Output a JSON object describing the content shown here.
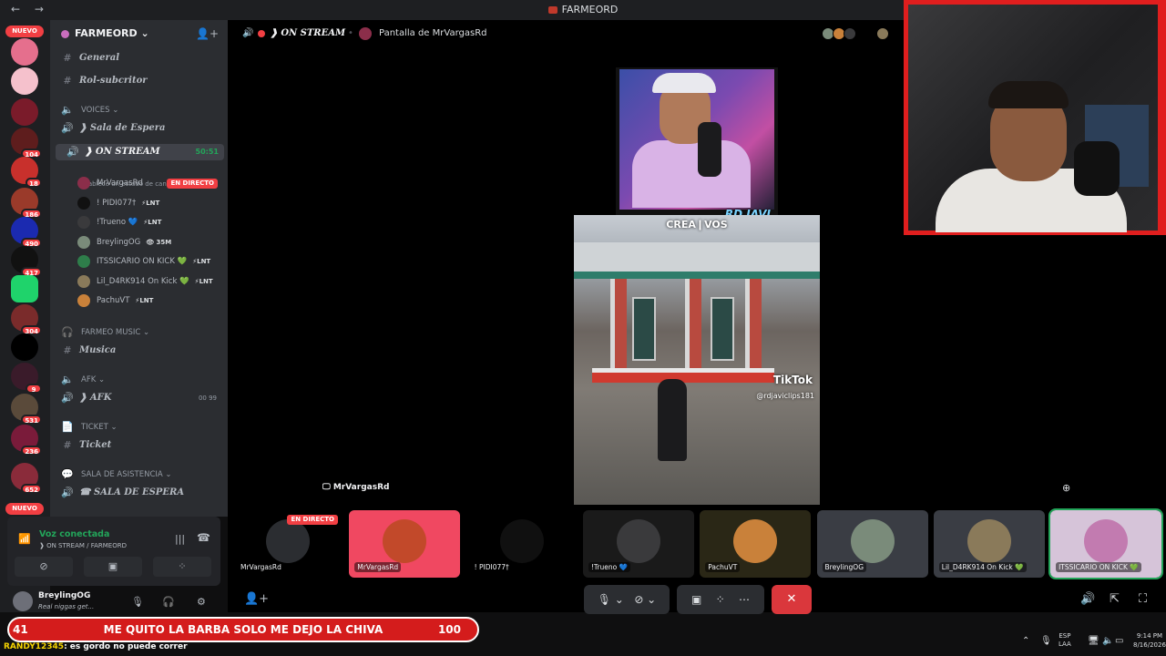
{
  "titlebar": {
    "nav": "← →",
    "title": "FARMEORD"
  },
  "servers": {
    "new1": "NUEVO",
    "new2": "NUEVO",
    "counts": [
      "104",
      "18",
      "186",
      "490",
      "417",
      "304",
      "9",
      "531",
      "236",
      "652"
    ]
  },
  "server": {
    "name": "FARMEORD ⌄"
  },
  "channels": [
    {
      "type": "text",
      "icon": "#",
      "label": "General"
    },
    {
      "type": "text",
      "icon": "#",
      "label": "Rol-subcritor"
    },
    {
      "type": "cat",
      "icon": "🔈",
      "label": "VOICES ⌄"
    },
    {
      "type": "voice",
      "icon": "🔊",
      "label": "❱ Sala de Espera"
    },
    {
      "type": "voice-active",
      "icon": "🔊",
      "label": "❱ ON STREAM",
      "timer": "50:51"
    }
  ],
  "channel_status": "Establece un estado de canal ✎",
  "voice_users": [
    {
      "name": "MrVargasRd",
      "tag": "",
      "badge": "EN DIRECTO"
    },
    {
      "name": "! PIDI077†",
      "tag": "⚡LNT",
      "badge": ""
    },
    {
      "name": "!Trueno 💙",
      "tag": "⚡LNT",
      "badge": ""
    },
    {
      "name": "BreylingOG",
      "tag": "👁 35M",
      "badge": ""
    },
    {
      "name": "ITSSICARIO ON KICK 💚",
      "tag": "⚡LNT",
      "badge": ""
    },
    {
      "name": "Lil_D4RK914 On Kick 💚",
      "tag": "⚡LNT",
      "badge": ""
    },
    {
      "name": "PachuVT",
      "tag": "⚡LNT",
      "badge": ""
    }
  ],
  "channels2": [
    {
      "type": "cat",
      "icon": "🎧",
      "label": "FARMEO MUSIC ⌄"
    },
    {
      "type": "text",
      "icon": "#",
      "label": "Musica"
    },
    {
      "type": "cat",
      "icon": "🔈",
      "label": "AFK ⌄"
    },
    {
      "type": "voice",
      "icon": "🔊",
      "label": "❱ AFK",
      "extra": "00 99"
    },
    {
      "type": "cat",
      "icon": "📄",
      "label": "TICKET ⌄"
    },
    {
      "type": "text",
      "icon": "#",
      "label": "Ticket"
    },
    {
      "type": "cat",
      "icon": "💬",
      "label": "SALA DE ASISTENCIA ⌄"
    },
    {
      "type": "voice",
      "icon": "🔊",
      "label": "☎ SALA DE ESPERA"
    }
  ],
  "voice": {
    "connected": "Voz conectada",
    "where": "❱ ON STREAM / FARMEORD"
  },
  "me": {
    "name": "BreylingOG",
    "status": "Real niggas get..."
  },
  "stage": {
    "channel": "❱ ON STREAM",
    "screen": "Pantalla de MrVargasRd",
    "share_label": "MrVargasRd",
    "overlay_crea": "CREA❙VOS",
    "overlay_rd": "RD JAVI",
    "tiktok": "TikTok",
    "tiktok_handle": "@rdjaviclips181"
  },
  "tiles": [
    {
      "name": "MrVargasRd",
      "badge": "EN DIRECTO",
      "color": "#000000",
      "avatar": "#2b2d31"
    },
    {
      "name": "MrVargasRd",
      "badge": "",
      "color": "#f04861",
      "avatar": "#c2492a"
    },
    {
      "name": "! PIDI077†",
      "badge": "",
      "color": "#000000",
      "avatar": "#101010"
    },
    {
      "name": "!Trueno 💙",
      "badge": "",
      "color": "#1a1a1a",
      "avatar": "#3a3a3c"
    },
    {
      "name": "PachuVT",
      "badge": "",
      "color": "#2a2716",
      "avatar": "#c9813a"
    },
    {
      "name": "BreylingOG",
      "badge": "",
      "color": "#3a3d44",
      "avatar": "#7a8b7a"
    },
    {
      "name": "Lil_D4RK914 On Kick 💚",
      "badge": "",
      "color": "#3a3d44",
      "avatar": "#8a7a5a"
    },
    {
      "name": "ITSSICARIO ON KICK 💚",
      "badge": "",
      "color": "#d6c4d9",
      "avatar": "#c27bb0"
    }
  ],
  "ticker": {
    "left": "41",
    "text": "ME QUITO LA BARBA SOLO ME DEJO LA CHIVA",
    "right": "100"
  },
  "chat": {
    "user": "RANDY12345",
    "msg": ": es gordo no puede correr"
  },
  "tray": {
    "lang": "ESP\nLAA",
    "time": "9:14 PM",
    "date": "8/16/2026"
  }
}
